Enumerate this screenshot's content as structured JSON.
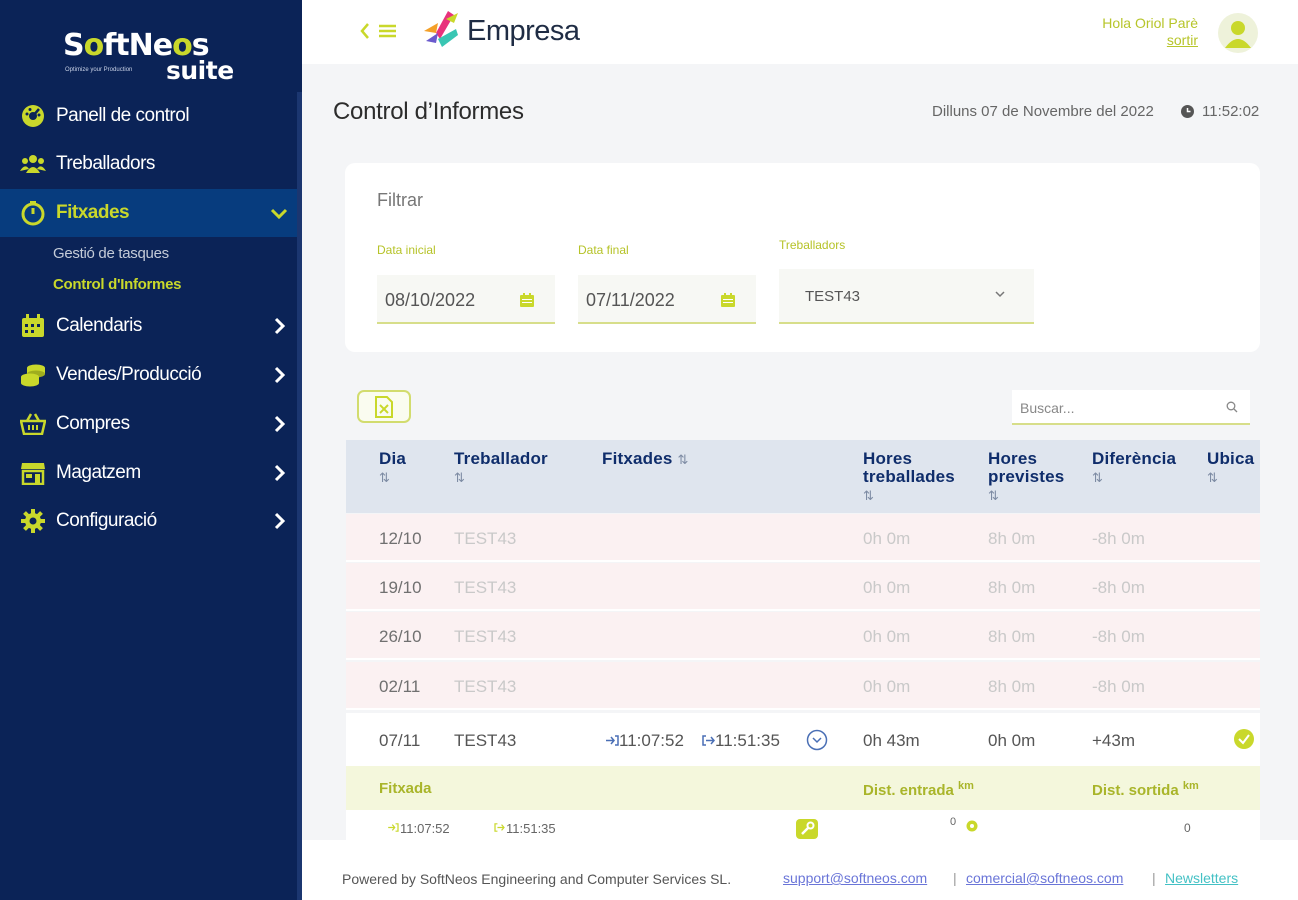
{
  "sidebar": {
    "logo": {
      "part1": "S",
      "part2": "ftNe",
      "part3": "s",
      "tagline": "Optimize your Production",
      "suite": "suite"
    },
    "items": [
      {
        "label": "Panell de control",
        "icon": "dashboard-icon"
      },
      {
        "label": "Treballadors",
        "icon": "users-icon"
      },
      {
        "label": "Fitxades",
        "icon": "stopwatch-icon"
      },
      {
        "label": "Calendaris",
        "icon": "calendar-icon"
      },
      {
        "label": "Vendes/Producció",
        "icon": "coins-icon"
      },
      {
        "label": "Compres",
        "icon": "basket-icon"
      },
      {
        "label": "Magatzem",
        "icon": "store-icon"
      },
      {
        "label": "Configuració",
        "icon": "gear-icon"
      }
    ],
    "subitems": [
      {
        "label": "Gestió de tasques"
      },
      {
        "label": "Control d'Informes"
      }
    ]
  },
  "topbar": {
    "brand": "Empresa",
    "greeting": "Hola Oriol Parè",
    "logout": "sortir"
  },
  "page": {
    "title": "Control d’Informes",
    "date": "Dilluns 07 de Novembre del 2022",
    "time": "11:52:02"
  },
  "filter": {
    "title": "Filtrar",
    "start_label": "Data inicial",
    "start_value": "08/10/2022",
    "end_label": "Data final",
    "end_value": "07/11/2022",
    "workers_label": "Treballadors",
    "workers_value": "TEST43"
  },
  "search": {
    "placeholder": "Buscar..."
  },
  "table": {
    "headers": {
      "dia": "Dia",
      "treballador": "Treballador",
      "fitxades": "Fitxades",
      "hores_treballades_1": "Hores",
      "hores_treballades_2": "treballades",
      "hores_previstes_1": "Hores",
      "hores_previstes_2": "previstes",
      "diferencia": "Diferència",
      "ubicacio": "Ubica",
      "sort": "⇅"
    },
    "rows": [
      {
        "dia": "12/10",
        "treballador": "TEST43",
        "hores_treballades": "0h 0m",
        "hores_previstes": "8h 0m",
        "diferencia": "-8h 0m"
      },
      {
        "dia": "19/10",
        "treballador": "TEST43",
        "hores_treballades": "0h 0m",
        "hores_previstes": "8h 0m",
        "diferencia": "-8h 0m"
      },
      {
        "dia": "26/10",
        "treballador": "TEST43",
        "hores_treballades": "0h 0m",
        "hores_previstes": "8h 0m",
        "diferencia": "-8h 0m"
      },
      {
        "dia": "02/11",
        "treballador": "TEST43",
        "hores_treballades": "0h 0m",
        "hores_previstes": "8h 0m",
        "diferencia": "-8h 0m"
      },
      {
        "dia": "07/11",
        "treballador": "TEST43",
        "entrada": "11:07:52",
        "sortida": "11:51:35",
        "hores_treballades": "0h 43m",
        "hores_previstes": "0h 0m",
        "diferencia": "+43m"
      }
    ],
    "detail": {
      "fitxada_label": "Fitxada",
      "dist_entrada_label": "Dist. entrada",
      "dist_sortida_label": "Dist. sortida",
      "unit": "km",
      "entrada": "11:07:52",
      "sortida": "11:51:35",
      "dist_entrada": "0",
      "dist_sortida": "0"
    }
  },
  "footer": {
    "powered": "Powered by SoftNeos Engineering and Computer Services SL.",
    "support": "support@softneos.com",
    "comercial": "comercial@softneos.com",
    "newsletters": "Newsletters",
    "sep": "|"
  },
  "colors": {
    "sidebar": "#0b2357",
    "accent": "#c9d82b",
    "header": "#dfe5ee",
    "pink_row": "#fbf1f2"
  }
}
